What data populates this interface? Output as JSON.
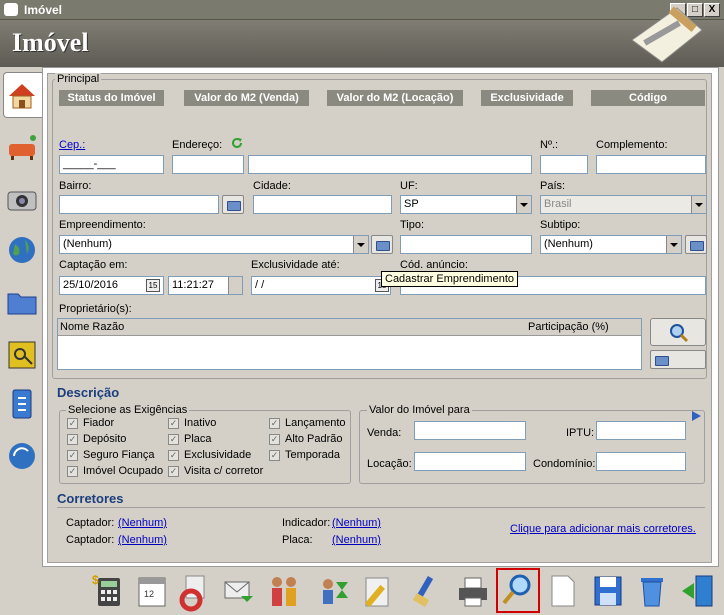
{
  "window": {
    "title": "Imóvel",
    "minimize": "_",
    "maximize": "□",
    "close": "X"
  },
  "header": {
    "title": "Imóvel"
  },
  "principal": {
    "label": "Principal",
    "status_buttons": [
      "Status do Imóvel",
      "Valor do M2 (Venda)",
      "Valor do M2 (Locação)",
      "Exclusividade",
      "Código"
    ]
  },
  "fields": {
    "cep": {
      "label": "Cep.:",
      "value": "_____-___"
    },
    "endereco": {
      "label": "Endereço:",
      "value": ""
    },
    "numero": {
      "label": "Nº.:",
      "value": ""
    },
    "complemento": {
      "label": "Complemento:",
      "value": ""
    },
    "bairro": {
      "label": "Bairro:",
      "value": ""
    },
    "cidade": {
      "label": "Cidade:",
      "value": ""
    },
    "uf": {
      "label": "UF:",
      "value": "SP"
    },
    "pais": {
      "label": "País:",
      "value": "Brasil"
    },
    "empreendimento": {
      "label": "Empreendimento:",
      "value": "(Nenhum)"
    },
    "tipo": {
      "label": "Tipo:",
      "value": ""
    },
    "subtipo": {
      "label": "Subtipo:",
      "value": "(Nenhum)"
    },
    "captacao": {
      "label": "Captação em:",
      "date": "25/10/2016",
      "cal": "15",
      "time": "11:21:27"
    },
    "exclusividade_ate": {
      "label": "Exclusividade até:",
      "value": " / /",
      "cal": "15"
    },
    "cod_anuncio": {
      "label": "Cód. anúncio:",
      "value": ""
    }
  },
  "tooltip": "Cadastrar Emprendimento",
  "proprietarios": {
    "label": "Proprietário(s):",
    "columns": [
      "Nome Razão",
      "Participação (%)"
    ]
  },
  "descricao": {
    "title": "Descrição",
    "exigencias_label": "Selecione as Exigências",
    "exigencias": [
      [
        "Fiador",
        "Inativo",
        "Lançamento"
      ],
      [
        "Depósito",
        "Placa",
        "Alto Padrão"
      ],
      [
        "Seguro Fiança",
        "Exclusividade",
        "Temporada"
      ],
      [
        "Imóvel Ocupado",
        "Visita c/ corretor",
        ""
      ]
    ],
    "check_mark": "✓",
    "valor_label": "Valor do Imóvel para",
    "venda": "Venda:",
    "iptu": "IPTU:",
    "locacao": "Locação:",
    "condominio": "Condomínio:"
  },
  "corretores": {
    "title": "Corretores",
    "captador1_label": "Captador:",
    "captador1_value": "(Nenhum)",
    "captador2_label": "Captador:",
    "captador2_value": "(Nenhum)",
    "indicador_label": "Indicador:",
    "indicador_value": "(Nenhum)",
    "placa_label": "Placa:",
    "placa_value": "(Nenhum)",
    "add_link": "Clique para adicionar mais corretores."
  },
  "icons": {
    "left": [
      "house-icon",
      "furniture-icon",
      "camera-icon",
      "globe-icon",
      "folder-icon",
      "keys-icon",
      "document-icon",
      "globe-refresh-icon"
    ],
    "toolbar": [
      "calculator-icon",
      "calendar-icon",
      "lifebuoy-icon",
      "email-icon",
      "people-icon",
      "transfer-icon",
      "edit-icon",
      "brush-icon",
      "printer-icon",
      "search-icon",
      "new-document-icon",
      "save-icon",
      "trash-icon",
      "exit-icon"
    ]
  },
  "colors": {
    "header_bg": "#6e6b63",
    "section_title": "#1c3e7c",
    "link": "#0000c0",
    "selected_highlight": "#d00000"
  }
}
